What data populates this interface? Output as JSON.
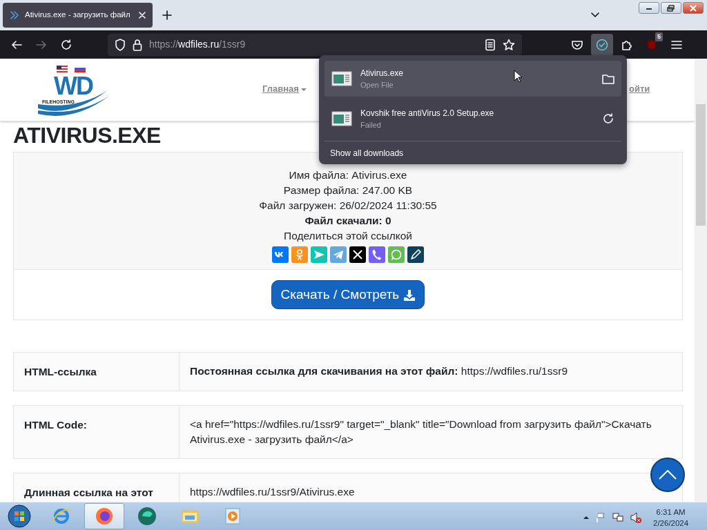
{
  "browser": {
    "tab": {
      "title": "Ativirus.exe - загрузить файл",
      "selected": true
    },
    "url": {
      "scheme": "https://",
      "host": "wdfiles.ru",
      "path": "/1ssr9"
    },
    "extension_badge": "5"
  },
  "downloads_panel": {
    "items": [
      {
        "name": "Ativirus.exe",
        "status": "Open File",
        "kind": "folder",
        "hovered": true
      },
      {
        "name": "Kovshik free antiVirus 2.0 Setup.exe",
        "status": "Failed",
        "kind": "retry",
        "hovered": false
      }
    ],
    "footer": "Show all downloads"
  },
  "page": {
    "logo": {
      "mark": "WD",
      "sub": "FILEHOSTING"
    },
    "nav": [
      {
        "label": "Главная",
        "dropdown": true
      },
      {
        "label": "ойти",
        "dropdown": false
      }
    ],
    "heading": "ATIVIRUS.EXE",
    "info": [
      {
        "label": "Имя файла:",
        "value": "Ativirus.exe",
        "bold": false
      },
      {
        "label": "Размер файла:",
        "value": "247.00 KB",
        "bold": false
      },
      {
        "label": "Файл загружен:",
        "value": "26/02/2024 11:30:55",
        "bold": false
      },
      {
        "label": "Файл скачали:",
        "value": "0",
        "bold": true
      }
    ],
    "share_label": "Поделиться этой ссылкой",
    "share": [
      {
        "kind": "vk",
        "color": "#0077ff"
      },
      {
        "kind": "ok",
        "color": "#f7931e"
      },
      {
        "kind": "plane",
        "color": "#13c4b0"
      },
      {
        "kind": "telegram",
        "color": "#64a9dc"
      },
      {
        "kind": "x",
        "color": "#000000"
      },
      {
        "kind": "viber",
        "color": "#7360f2"
      },
      {
        "kind": "whatsapp",
        "color": "#65bc54"
      },
      {
        "kind": "pencil",
        "color": "#0d425a"
      }
    ],
    "download_button": "Скачать / Смотреть",
    "rows": [
      {
        "label": "HTML-ссылка",
        "text": "**Постоянная ссылка для скачивания на этот файл:** https://wdfiles.ru/1ssr9"
      },
      {
        "label": "HTML Code:",
        "text": "<a href=\"https://wdfiles.ru/1ssr9\" target=\"_blank\" title=\"Download from загрузить файл\">Скачать Ativirus.exe - загрузить файл</a>"
      },
      {
        "label": "Длинная ссылка на этот",
        "text": "https://wdfiles.ru/1ssr9/Ativirus.exe"
      }
    ]
  },
  "taskbar": {
    "apps": [
      {
        "kind": "ie",
        "selected": false
      },
      {
        "kind": "firefox",
        "selected": true
      },
      {
        "kind": "green",
        "selected": false
      },
      {
        "kind": "folder",
        "selected": false
      },
      {
        "kind": "media",
        "selected": false
      }
    ],
    "time": "6:31 AM",
    "date": "2/26/2024"
  }
}
